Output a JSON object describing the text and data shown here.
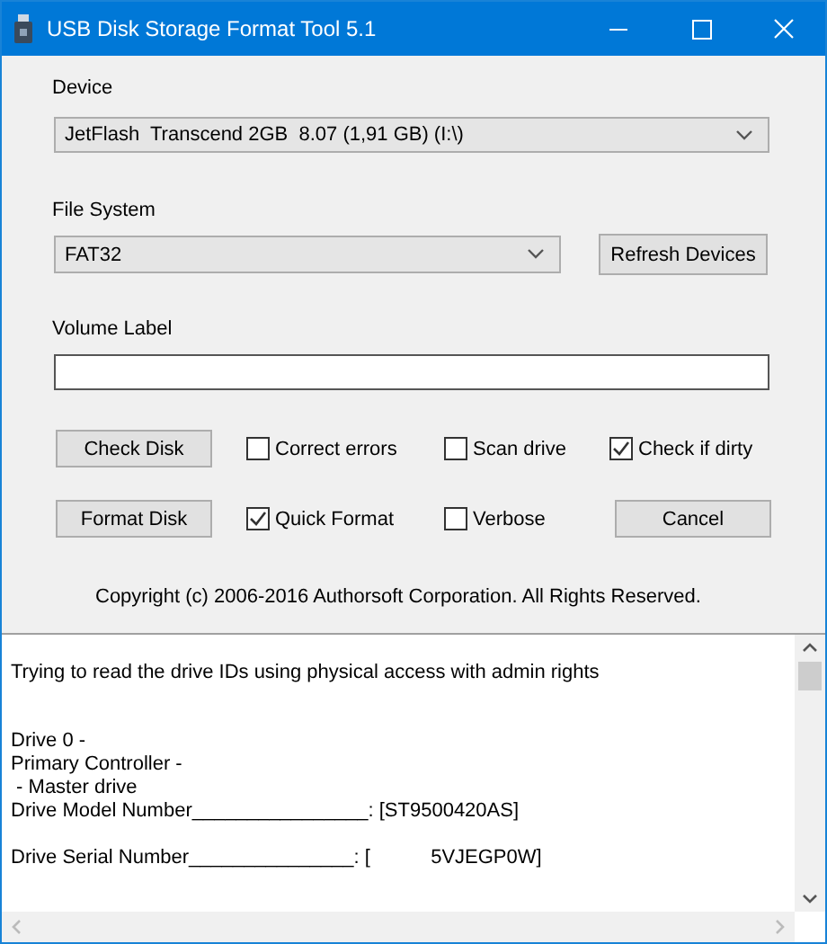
{
  "window": {
    "title": "USB Disk Storage Format Tool 5.1"
  },
  "device": {
    "label": "Device",
    "value": "JetFlash  Transcend 2GB  8.07 (1,91 GB) (I:\\)"
  },
  "file_system": {
    "label": "File System",
    "value": "FAT32",
    "button": "Refresh Devices"
  },
  "volume_label": {
    "label": "Volume Label"
  },
  "controls": [
    {
      "kind": "button",
      "label": "Check Disk"
    },
    {
      "kind": "checkbox",
      "label": "Correct errors",
      "checked": false
    },
    {
      "kind": "checkbox",
      "label": "Scan drive",
      "checked": false
    },
    {
      "kind": "checkbox",
      "label": "Check if dirty",
      "checked": true
    },
    {
      "kind": "button",
      "label": "Format Disk"
    },
    {
      "kind": "checkbox",
      "label": "Quick Format",
      "checked": true
    },
    {
      "kind": "checkbox",
      "label": "Verbose",
      "checked": false
    },
    {
      "kind": "button",
      "label": "Cancel"
    }
  ],
  "copyright": "Copyright (c) 2006-2016 Authorsoft Corporation. All Rights Reserved.",
  "log": {
    "blocks": [
      [
        "Trying to read the drive IDs using physical access with admin rights"
      ],
      [
        "Drive 0 -",
        "Primary Controller -",
        " - Master drive",
        "Drive Model Number________________: [ST9500420AS]"
      ],
      [
        "Drive Serial Number_______________: [           5VJEGP0W]"
      ]
    ]
  }
}
